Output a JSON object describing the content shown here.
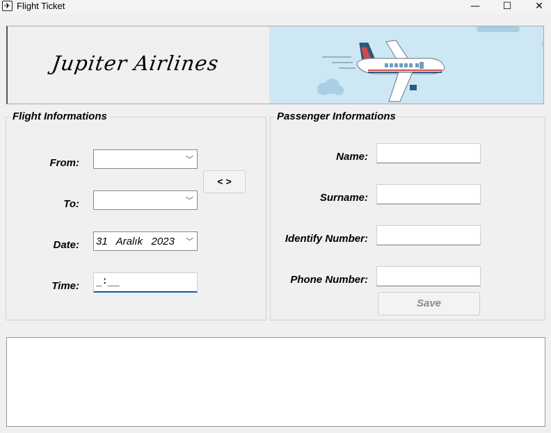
{
  "window": {
    "title": "Flight Ticket",
    "minimize": "—",
    "maximize": "☐",
    "close": "✕",
    "icon": "airplane-icon"
  },
  "banner": {
    "brand": "Jupiter Airlines"
  },
  "flight": {
    "title": "Flight Informations",
    "from_label": "From:",
    "to_label": "To:",
    "date_label": "Date:",
    "time_label": "Time:",
    "from_value": "",
    "to_value": "",
    "date_value": "31   Aralık   2023",
    "time_value": "_:__",
    "swap_button": "< >"
  },
  "passenger": {
    "title": "Passenger Informations",
    "name_label": "Name:",
    "surname_label": "Surname:",
    "id_label": "Identify Number:",
    "phone_label": "Phone Number:",
    "save_button": "Save"
  },
  "colors": {
    "accent": "#0f5aa8",
    "sky": "#cde7f5"
  }
}
